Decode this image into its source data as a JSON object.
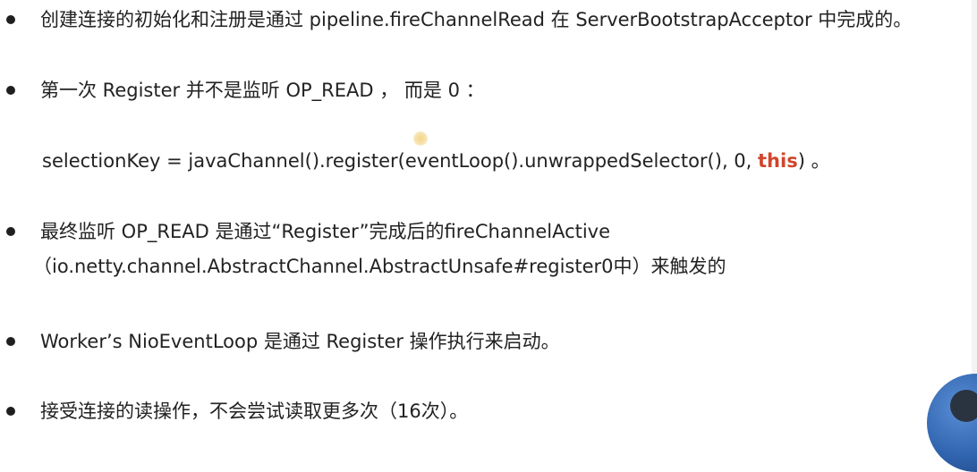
{
  "bullets": [
    {
      "text": "创建连接的初始化和注册是通过 pipeline.fireChannelRead 在 ServerBootstrapAcceptor 中完成的。"
    },
    {
      "text": "第一次 Register 并不是监听 OP_READ ， 而是 0 ："
    },
    {
      "text": "最终监听 OP_READ 是通过“Register”完成后的fireChannelActive"
    },
    {
      "text": "Worker’s NioEventLoop 是通过 Register 操作执行来启动。"
    },
    {
      "text": "接受连接的读操作，不会尝试读取更多次（16次）。"
    }
  ],
  "bullet3_continuation": "（io.netty.channel.AbstractChannel.AbstractUnsafe#register0中）来触发的",
  "code": {
    "prefix": "selectionKey = javaChannel().register(eventLoop().unwrappedSelector(), 0, ",
    "highlight": "this",
    "suffix": ") 。"
  },
  "colors": {
    "text": "#222222",
    "highlight": "#d0452a",
    "bullet": "#1f1f1f",
    "background": "#ffffff"
  }
}
